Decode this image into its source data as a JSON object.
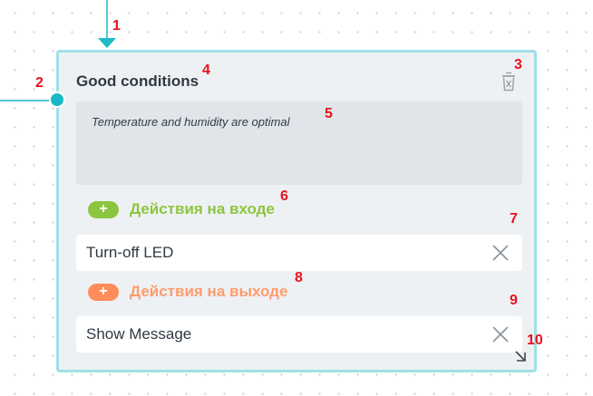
{
  "state": {
    "title": "Good conditions",
    "description": "Temperature and humidity are optimal"
  },
  "enter_actions": {
    "header_label": "Действия на входе",
    "add_symbol": "+",
    "items": [
      "Turn-off LED"
    ]
  },
  "exit_actions": {
    "header_label": "Действия на выходе",
    "add_symbol": "+",
    "items": [
      "Show Message"
    ]
  },
  "annotations": [
    "1",
    "2",
    "3",
    "4",
    "5",
    "6",
    "7",
    "8",
    "9",
    "10"
  ],
  "colors": {
    "accent": "#17b9c4",
    "card_border": "#9fe0e5",
    "enter_green": "#8cc63f",
    "exit_orange": "#ff8c5a",
    "annotation_red": "#e8101a"
  }
}
